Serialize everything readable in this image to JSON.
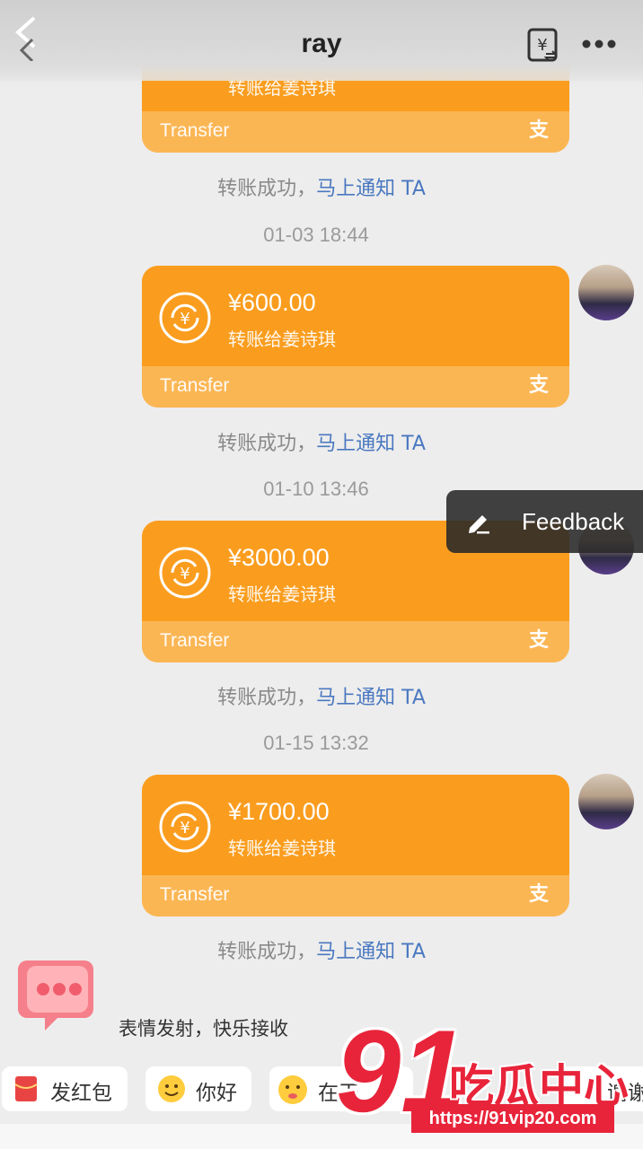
{
  "header": {
    "title": "ray"
  },
  "transfers": [
    {
      "amount": "",
      "recipient": "转账给姜诗琪",
      "footer_label": "Transfer",
      "pay_icon": "支"
    },
    {
      "amount": "¥600.00",
      "recipient": "转账给姜诗琪",
      "footer_label": "Transfer",
      "pay_icon": "支"
    },
    {
      "amount": "¥3000.00",
      "recipient": "转账给姜诗琪",
      "footer_label": "Transfer",
      "pay_icon": "支"
    },
    {
      "amount": "¥1700.00",
      "recipient": "转账给姜诗琪",
      "footer_label": "Transfer",
      "pay_icon": "支"
    }
  ],
  "status": {
    "success_text": "转账成功，",
    "notify_link": "马上通知 TA"
  },
  "timestamps": [
    "01-03 18:44",
    "01-10 13:46",
    "01-15 13:32"
  ],
  "feedback": {
    "label": "Feedback"
  },
  "bottom": {
    "hint": "表情发射，快乐接收",
    "chips": [
      "发红包",
      "你好",
      "在干",
      "谢谢"
    ]
  },
  "watermark": {
    "number": "91",
    "brand": "吃瓜中心",
    "url": "https://91vip20.com"
  },
  "colors": {
    "card_top": "#fa9d1e",
    "card_bottom": "#fbb654",
    "notify_link": "#4a78c0",
    "background": "#ededed",
    "watermark_red": "#e8243a"
  },
  "icons": [
    "back-icon",
    "yuan-exchange-icon",
    "more-icon",
    "transfer-coin-icon",
    "alipay-icon",
    "edit-icon",
    "red-packet-icon",
    "emoji-icon",
    "chat-bubble-icon"
  ]
}
